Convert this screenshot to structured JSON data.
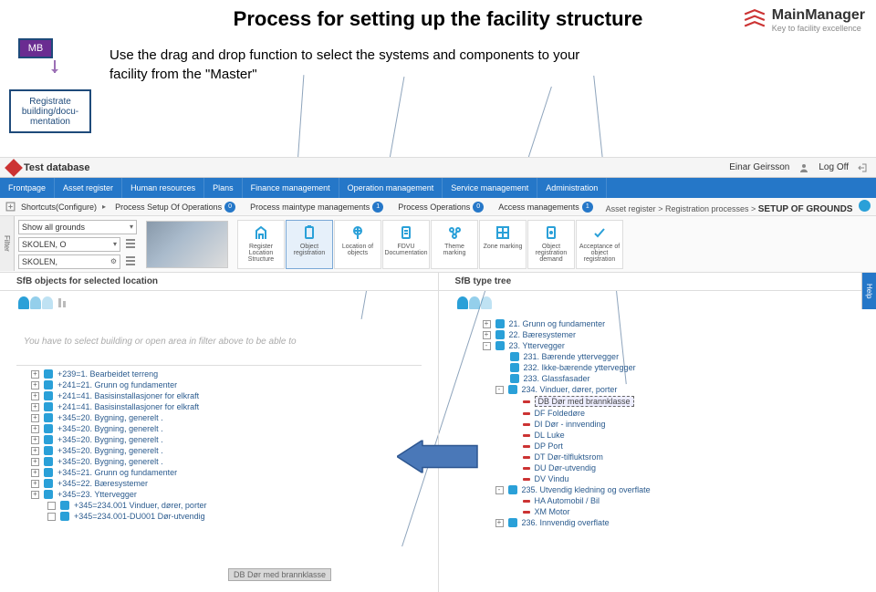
{
  "slide": {
    "title": "Process for setting up the facility structure",
    "mb_label": "MB",
    "reg_label": "Registrate building/docu-mentation",
    "body_text": "Use the drag and drop function to select the systems and components to your facility from the \"Master\""
  },
  "logo": {
    "name": "MainManager",
    "sub": "Key to facility excellence"
  },
  "titlebar": {
    "db": "Test database",
    "user": "Einar Geirsson",
    "logoff": "Log Off"
  },
  "nav": [
    "Frontpage",
    "Asset register",
    "Human resources",
    "Plans",
    "Finance management",
    "Operation management",
    "Service management",
    "Administration"
  ],
  "subbar": {
    "shortcuts": "Shortcuts(Configure)",
    "tabs": [
      {
        "label": "Process Setup Of Operations",
        "badge": "0"
      },
      {
        "label": "Process maintype managements",
        "badge": "1"
      },
      {
        "label": "Process Operations",
        "badge": "0"
      },
      {
        "label": "Access managements",
        "badge": "1"
      }
    ],
    "crumb_a": "Asset register",
    "crumb_b": "Registration processes",
    "crumb_c": "SETUP OF GROUNDS"
  },
  "filters": {
    "labels": [
      "Show all grounds",
      "SKOLEN, O",
      "SKOLEN,"
    ],
    "actions": [
      {
        "label": "Register Location Structure"
      },
      {
        "label": "Object registration",
        "active": true
      },
      {
        "label": "Location of objects"
      },
      {
        "label": "FDVU Documentation"
      },
      {
        "label": "Theme marking"
      },
      {
        "label": "Zone marking"
      },
      {
        "label": "Object registration demand"
      },
      {
        "label": "Acceptance of object registration"
      }
    ]
  },
  "side_filter": "Filter",
  "side_help": "Help",
  "panel_left": {
    "title": "SfB objects for selected location",
    "msg": "You have to select building or open area in filter above to be able to",
    "rows": [
      "+239=1. Bearbeidet terreng",
      "+241=21. Grunn og fundamenter",
      "+241=41. Basisinstallasjoner for elkraft",
      "+241=41. Basisinstallasjoner for elkraft",
      "+345=20. Bygning, generelt .",
      "+345=20. Bygning, generelt .",
      "+345=20. Bygning, generelt .",
      "+345=20. Bygning, generelt .",
      "+345=20. Bygning, generelt .",
      "+345=21. Grunn og fundamenter",
      "+345=22. Bæresystemer",
      "+345=23. Yttervegger",
      "+345=234.001 Vinduer, dører, porter",
      "+345=234.001-DU001 Dør-utvendig"
    ],
    "drag_ghost": "DB Dør med brannklasse"
  },
  "panel_right": {
    "title": "SfB type tree",
    "rows": [
      {
        "lvl": 1,
        "exp": "+",
        "txt": "21. Grunn og fundamenter"
      },
      {
        "lvl": 1,
        "exp": "+",
        "txt": "22. Bæresystemer"
      },
      {
        "lvl": 1,
        "exp": "-",
        "txt": "23. Yttervegger"
      },
      {
        "lvl": 2,
        "exp": "",
        "txt": "231. Bærende yttervegger"
      },
      {
        "lvl": 2,
        "exp": "",
        "txt": "232. Ikke-bærende yttervegger"
      },
      {
        "lvl": 2,
        "exp": "",
        "txt": "233. Glassfasader"
      },
      {
        "lvl": 2,
        "exp": "-",
        "txt": "234. Vinduer, dører, porter"
      },
      {
        "lvl": 3,
        "exp": "",
        "txt": "DB Dør med brannklasse",
        "sel": true
      },
      {
        "lvl": 3,
        "exp": "",
        "txt": "DF Foldedøre"
      },
      {
        "lvl": 3,
        "exp": "",
        "txt": "DI Dør - innvending"
      },
      {
        "lvl": 3,
        "exp": "",
        "txt": "DL Luke"
      },
      {
        "lvl": 3,
        "exp": "",
        "txt": "DP Port"
      },
      {
        "lvl": 3,
        "exp": "",
        "txt": "DT Dør-tilfluktsrom"
      },
      {
        "lvl": 3,
        "exp": "",
        "txt": "DU Dør-utvendig"
      },
      {
        "lvl": 3,
        "exp": "",
        "txt": "DV Vindu"
      },
      {
        "lvl": 2,
        "exp": "-",
        "txt": "235. Utvendig kledning og overflate"
      },
      {
        "lvl": 3,
        "exp": "",
        "txt": "HA Automobil / Bil"
      },
      {
        "lvl": 3,
        "exp": "",
        "txt": "XM Motor"
      },
      {
        "lvl": 2,
        "exp": "+",
        "txt": "236. Innvendig overflate"
      }
    ]
  }
}
